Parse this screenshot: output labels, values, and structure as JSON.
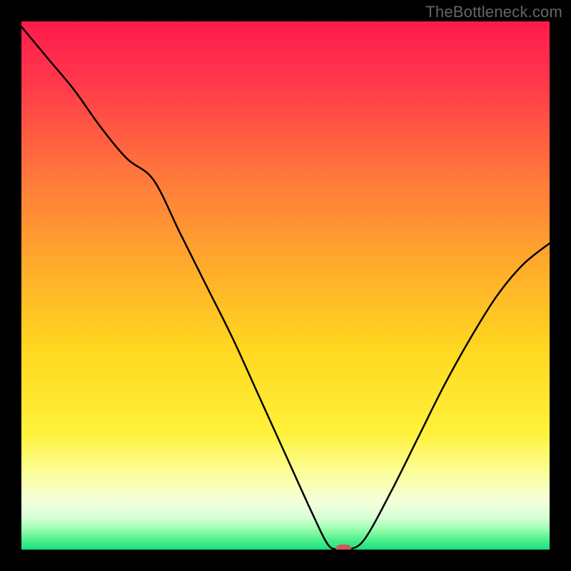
{
  "watermark": "TheBottleneck.com",
  "chart_data": {
    "type": "line",
    "title": "",
    "xlabel": "",
    "ylabel": "",
    "xlim": [
      0,
      100
    ],
    "ylim": [
      0,
      100
    ],
    "x": [
      0,
      5,
      10,
      15,
      20,
      25,
      30,
      35,
      40,
      45,
      50,
      55,
      58,
      60,
      62,
      65,
      70,
      75,
      80,
      85,
      90,
      95,
      100
    ],
    "values": [
      99,
      93,
      87,
      80,
      74,
      70,
      60,
      50,
      40,
      29,
      18,
      7,
      1,
      0,
      0,
      2,
      11,
      21,
      31,
      40,
      48,
      54,
      58
    ],
    "series_name": "bottleneck-curve",
    "background": "red-green-gradient",
    "marker": {
      "x": 61,
      "y": 0,
      "color": "#cf5a5a",
      "shape": "rounded-rect"
    }
  }
}
